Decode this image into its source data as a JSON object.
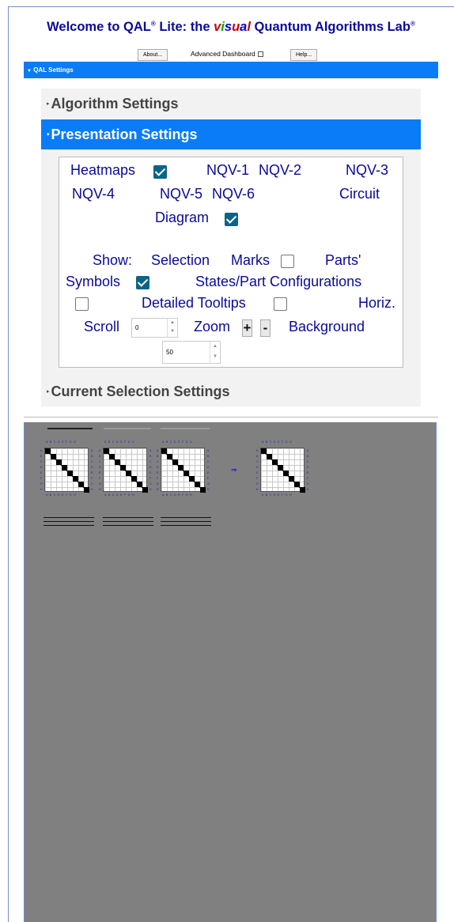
{
  "header": {
    "title_prefix": "Welcome to QAL",
    "title_reg1": "®",
    "title_mid": " Lite: the ",
    "title_visual_letters": [
      "v",
      "i",
      "s",
      "u",
      "a",
      "l"
    ],
    "title_suffix": " Quantum Algorithms Lab",
    "title_reg2": "®"
  },
  "toolbar": {
    "about_label": "About...",
    "advanced_label": "Advanced Dashboard",
    "advanced_checked": false,
    "help_label": "Help..."
  },
  "qal_settings": {
    "label": "QAL Settings",
    "expanded": true
  },
  "sections": {
    "algorithm": {
      "label": "Algorithm Settings",
      "expanded": false
    },
    "presentation": {
      "label": "Presentation Settings",
      "expanded": true
    },
    "current_selection": {
      "label": "Current Selection Settings",
      "expanded": false
    }
  },
  "presentation": {
    "heatmaps_label": "Heatmaps",
    "heatmaps_checked": true,
    "nqv1": "NQV-1",
    "nqv2": "NQV-2",
    "nqv3": "NQV-3",
    "nqv4": "NQV-4",
    "nqv5": "NQV-5",
    "nqv6": "NQV-6",
    "circuit_word": "Circuit",
    "diagram_word": "Diagram",
    "circuit_diagram_checked": true,
    "show_label": "Show:",
    "selection_word": "Selection",
    "marks_word": "Marks",
    "selection_marks_checked": false,
    "parts_word": "Parts'",
    "symbols_word": "Symbols",
    "parts_symbols_checked": true,
    "states_label": "States/Part Configurations",
    "states_checked": false,
    "detailed_tooltips_label": "Detailed Tooltips",
    "detailed_tooltips_checked": false,
    "horiz_word": "Horiz.",
    "scroll_word": "Scroll",
    "scroll_value": "0",
    "zoom_label": "Zoom",
    "zoom_plus": "+",
    "zoom_minus": "-",
    "background_label": "Background",
    "background_value": "50"
  },
  "workspace": {
    "background_color": "#808080",
    "column_letters": "ABCDEFGH",
    "row_letters": [
      "A",
      "B",
      "C",
      "D",
      "E",
      "F",
      "G",
      "H"
    ],
    "result_arrow": "⇒",
    "accent_color": "#0a7cf7"
  }
}
